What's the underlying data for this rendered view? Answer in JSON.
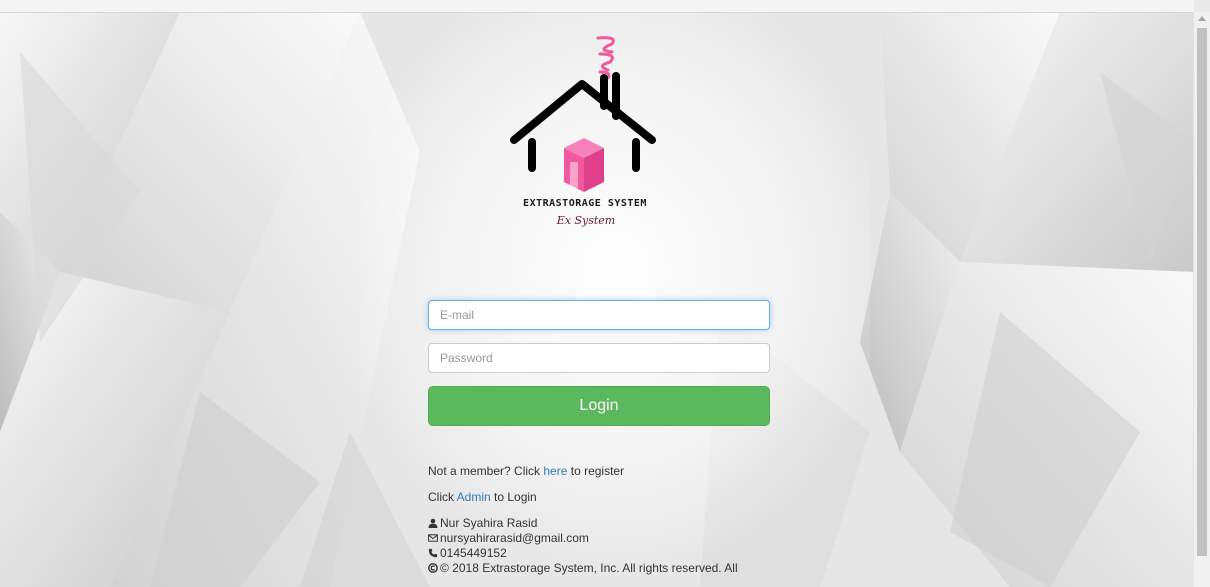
{
  "brand": {
    "name": "EXTRASTORAGE SYSTEM",
    "script": "Ex System"
  },
  "form": {
    "email_placeholder": "E-mail",
    "password_placeholder": "Password",
    "login_label": "Login"
  },
  "register": {
    "prefix": "Not a member? Click ",
    "link": "here",
    "suffix": " to register"
  },
  "admin": {
    "prefix": "Click ",
    "link": "Admin",
    "suffix": " to Login"
  },
  "contact": {
    "name": "Nur Syahira Rasid",
    "email": "nursyahirarasid@gmail.com",
    "phone": "0145449152",
    "copyright": "© 2018 Extrastorage System, Inc. All rights reserved. All"
  },
  "colors": {
    "login_button": "#5cb85c",
    "link": "#337ab7",
    "logo_pink": "#f2589e"
  }
}
